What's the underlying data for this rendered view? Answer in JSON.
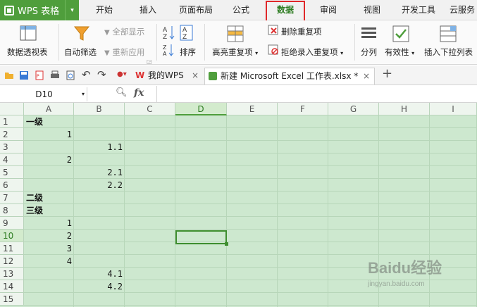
{
  "app": {
    "name": "WPS 表格"
  },
  "menu_tabs": [
    "开始",
    "插入",
    "页面布局",
    "公式",
    "数据",
    "审阅",
    "视图",
    "开发工具",
    "云服务"
  ],
  "active_tab": "数据",
  "ribbon": {
    "pivot": "数据透视表",
    "autofilter": "自动筛选",
    "show_all": "全部显示",
    "reapply": "重新应用",
    "sort": "排序",
    "highlight_dup": "高亮重复项",
    "remove_dup": "删除重复项",
    "reject_dup": "拒绝录入重复项",
    "split": "分列",
    "validity": "有效性",
    "dropdown": "插入下拉列表"
  },
  "doc_tabs": {
    "wps": "我的WPS",
    "file": "新建 Microsoft Excel 工作表.xlsx *"
  },
  "namebox": "D10",
  "fx": "fx",
  "columns": [
    "A",
    "B",
    "C",
    "D",
    "E",
    "F",
    "G",
    "H",
    "I"
  ],
  "active_col": "D",
  "rows": [
    "1",
    "2",
    "3",
    "4",
    "5",
    "6",
    "7",
    "8",
    "9",
    "10",
    "11",
    "12",
    "13",
    "14",
    "15"
  ],
  "active_row": "10",
  "cells": {
    "A1": "一级",
    "A2": "1",
    "B3": "1.1",
    "A4": "2",
    "B5": "2.1",
    "B6": "2.2",
    "A7": "二级",
    "A8": "三级",
    "A9": "1",
    "A10": "2",
    "A11": "3",
    "A12": "4",
    "B13": "4.1",
    "B14": "4.2"
  },
  "watermark": {
    "brand": "Baidu经验",
    "url": "jingyan.baidu.com"
  }
}
